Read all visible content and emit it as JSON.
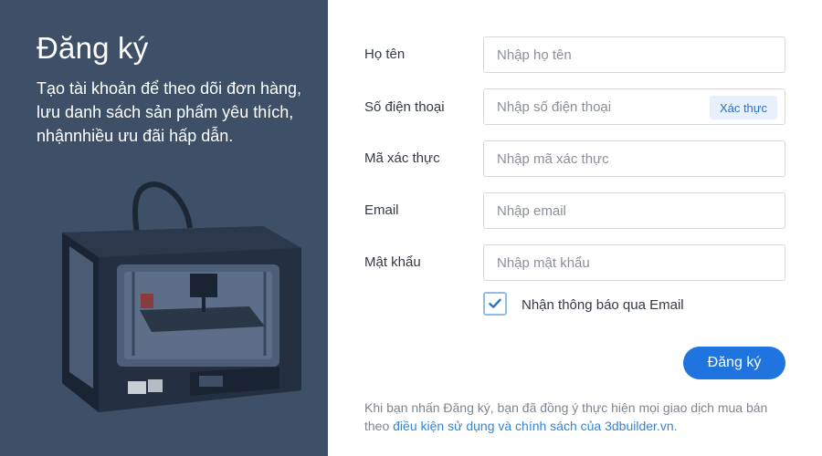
{
  "left": {
    "title": "Đăng ký",
    "subtitle": "Tạo tài khoản để theo dõi đơn hàng, lưu danh sách sản phẩm yêu thích, nhậnnhiều ưu đãi hấp dẫn."
  },
  "form": {
    "name": {
      "label": "Họ tên",
      "placeholder": "Nhập họ tên"
    },
    "phone": {
      "label": "Số điện thoại",
      "placeholder": "Nhập số điện thoại",
      "verify_label": "Xác thực"
    },
    "code": {
      "label": "Mã xác thực",
      "placeholder": "Nhập mã xác thực"
    },
    "email": {
      "label": "Email",
      "placeholder": "Nhập email"
    },
    "password": {
      "label": "Mật khẩu",
      "placeholder": "Nhập mật khẩu"
    },
    "newsletter": {
      "label": "Nhận thông báo qua Email",
      "checked": true
    },
    "submit_label": "Đăng ký"
  },
  "terms": {
    "prefix": "Khi bạn nhấn Đăng ký, bạn đã đồng ý thực hiện mọi giao dịch mua bán theo ",
    "link": "điều kiện sử dụng và chính sách của 3dbuilder.vn",
    "suffix": "."
  },
  "colors": {
    "panel": "#3d5068",
    "accent": "#1f74e0",
    "link": "#2f86d8"
  }
}
